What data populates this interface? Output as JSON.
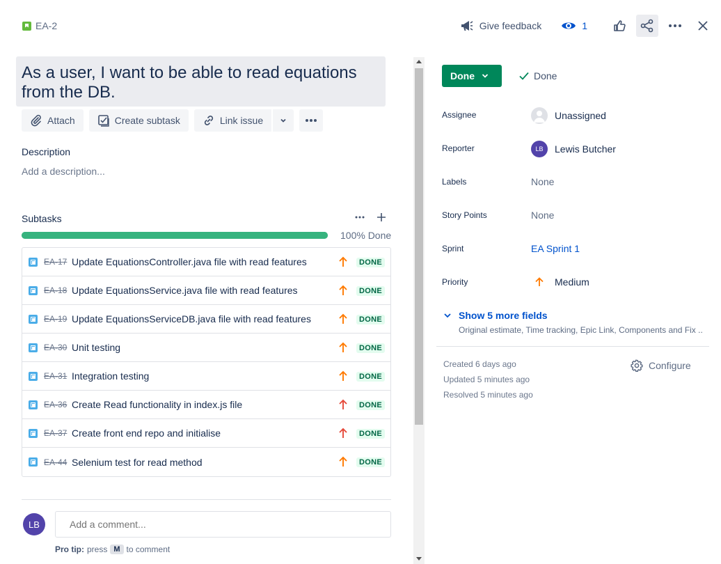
{
  "issue": {
    "key": "EA-2",
    "title": "As a user, I want to be able to read equations from the DB."
  },
  "topbar": {
    "feedback_label": "Give feedback",
    "watch_count": "1"
  },
  "actions": {
    "attach": "Attach",
    "create_subtask": "Create subtask",
    "link_issue": "Link issue"
  },
  "description": {
    "heading": "Description",
    "placeholder": "Add a description..."
  },
  "subtasks": {
    "heading": "Subtasks",
    "progress_label": "100% Done",
    "progress_fraction": 1.0,
    "items": [
      {
        "key": "EA-17",
        "summary": "Update EquationsController.java file with read features",
        "priority": "medium",
        "status": "DONE"
      },
      {
        "key": "EA-18",
        "summary": "Update EquationsService.java file with read features",
        "priority": "medium",
        "status": "DONE"
      },
      {
        "key": "EA-19",
        "summary": "Update EquationsServiceDB.java file with read features",
        "priority": "medium",
        "status": "DONE"
      },
      {
        "key": "EA-30",
        "summary": "Unit testing",
        "priority": "medium",
        "status": "DONE"
      },
      {
        "key": "EA-31",
        "summary": "Integration testing",
        "priority": "medium",
        "status": "DONE"
      },
      {
        "key": "EA-36",
        "summary": "Create Read functionality in index.js file",
        "priority": "high",
        "status": "DONE"
      },
      {
        "key": "EA-37",
        "summary": "Create front end repo and initialise",
        "priority": "high",
        "status": "DONE"
      },
      {
        "key": "EA-44",
        "summary": "Selenium test for read method",
        "priority": "medium",
        "status": "DONE"
      }
    ]
  },
  "comment": {
    "avatar_initials": "LB",
    "placeholder": "Add a comment...",
    "protip_bold": "Pro tip:",
    "protip_press": "press",
    "protip_key": "M",
    "protip_rest": "to comment"
  },
  "status": {
    "button_label": "Done",
    "resolution": "Done"
  },
  "fields": {
    "assignee_label": "Assignee",
    "assignee_value": "Unassigned",
    "reporter_label": "Reporter",
    "reporter_value": "Lewis Butcher",
    "reporter_initials": "LB",
    "labels_label": "Labels",
    "labels_value": "None",
    "story_points_label": "Story Points",
    "story_points_value": "None",
    "sprint_label": "Sprint",
    "sprint_value": "EA Sprint 1",
    "priority_label": "Priority",
    "priority_value": "Medium"
  },
  "more_fields": {
    "label": "Show 5 more fields",
    "sub": "Original estimate, Time tracking, Epic Link, Components and Fix ..."
  },
  "meta": {
    "created": "Created 6 days ago",
    "updated": "Updated 5 minutes ago",
    "resolved": "Resolved 5 minutes ago",
    "configure": "Configure"
  },
  "colors": {
    "status_green": "#00875a",
    "priority_medium": "#ff7a00",
    "priority_high": "#e5493a",
    "link_blue": "#0052cc"
  }
}
